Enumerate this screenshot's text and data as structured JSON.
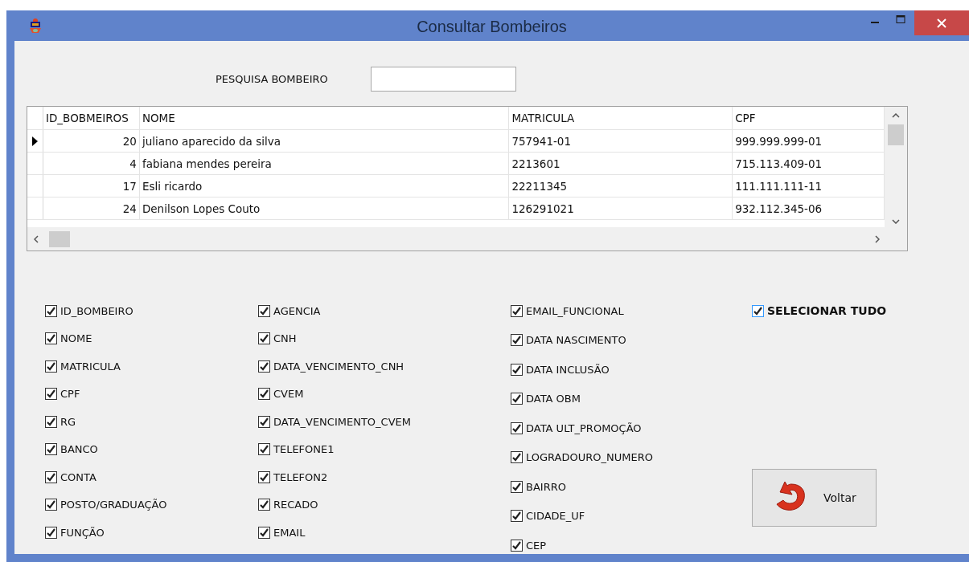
{
  "window": {
    "title": "Consultar Bombeiros"
  },
  "search": {
    "label": "PESQUISA BOMBEIRO"
  },
  "table": {
    "columns": [
      "ID_BOBMEIROS",
      "NOME",
      "MATRICULA",
      "CPF"
    ],
    "rows": [
      {
        "current": true,
        "cells": [
          "20",
          "juliano aparecido da silva",
          "757941-01",
          "999.999.999-01"
        ]
      },
      {
        "current": false,
        "cells": [
          "4",
          "fabiana mendes pereira",
          "2213601",
          "715.113.409-01"
        ]
      },
      {
        "current": false,
        "cells": [
          "17",
          "Esli ricardo",
          "22211345",
          "111.111.111-11"
        ]
      },
      {
        "current": false,
        "cells": [
          "24",
          "Denilson Lopes Couto",
          "126291021",
          "932.112.345-06"
        ]
      }
    ]
  },
  "field_columns": [
    [
      {
        "label": "ID_BOMBEIRO",
        "checked": true
      },
      {
        "label": "NOME",
        "checked": true
      },
      {
        "label": "MATRICULA",
        "checked": true
      },
      {
        "label": "CPF",
        "checked": true
      },
      {
        "label": "RG",
        "checked": true
      },
      {
        "label": "BANCO",
        "checked": true
      },
      {
        "label": "CONTA",
        "checked": true
      },
      {
        "label": "POSTO/GRADUAÇÃO",
        "checked": true
      },
      {
        "label": "FUNÇÃO",
        "checked": true
      }
    ],
    [
      {
        "label": "AGENCIA",
        "checked": true
      },
      {
        "label": "CNH",
        "checked": true
      },
      {
        "label": "DATA_VENCIMENTO_CNH",
        "checked": true
      },
      {
        "label": "CVEM",
        "checked": true
      },
      {
        "label": "DATA_VENCIMENTO_CVEM",
        "checked": true
      },
      {
        "label": "TELEFONE1",
        "checked": true
      },
      {
        "label": "TELEFON2",
        "checked": true
      },
      {
        "label": "RECADO",
        "checked": true
      },
      {
        "label": "EMAIL",
        "checked": true
      }
    ],
    [
      {
        "label": "EMAIL_FUNCIONAL",
        "checked": true
      },
      {
        "label": "DATA NASCIMENTO",
        "checked": true
      },
      {
        "label": "DATA INCLUSÃO",
        "checked": true
      },
      {
        "label": "DATA OBM",
        "checked": true
      },
      {
        "label": "DATA ULT_PROMOÇÃO",
        "checked": true
      },
      {
        "label": "LOGRADOURO_NUMERO",
        "checked": true
      },
      {
        "label": "BAIRRO",
        "checked": true
      },
      {
        "label": "CIDADE_UF",
        "checked": true
      },
      {
        "label": "CEP",
        "checked": true
      }
    ]
  ],
  "select_all": {
    "label": "SELECIONAR TUDO",
    "checked": true
  },
  "buttons": [
    {
      "label": "Voltar"
    }
  ]
}
